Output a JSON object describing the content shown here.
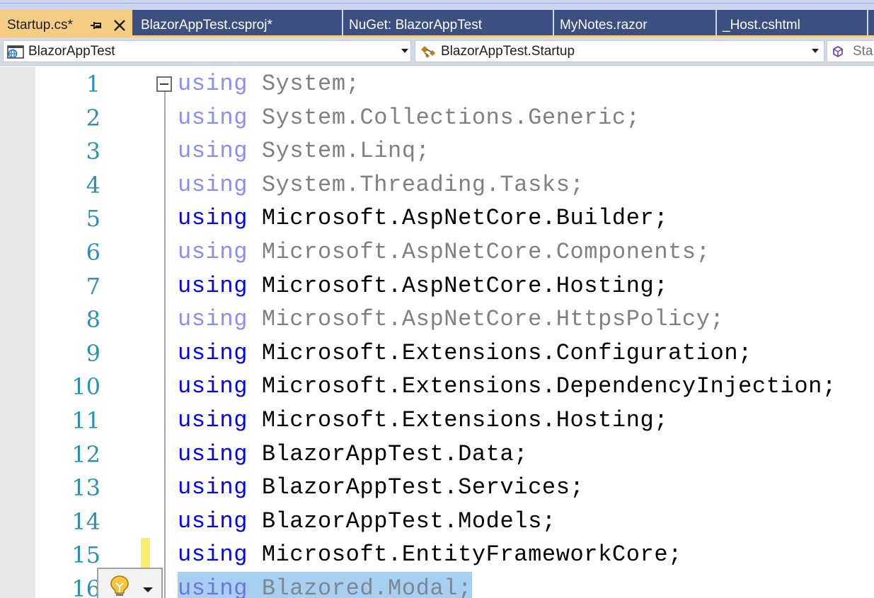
{
  "tabs": [
    {
      "label": "Startup.cs*",
      "active": true
    },
    {
      "label": "BlazorAppTest.csproj*",
      "active": false
    },
    {
      "label": "NuGet: BlazorAppTest",
      "active": false
    },
    {
      "label": "MyNotes.razor",
      "active": false
    },
    {
      "label": "_Host.cshtml",
      "active": false
    }
  ],
  "nav": {
    "project": "BlazorAppTest",
    "type": "BlazorAppTest.Startup",
    "member": "Sta"
  },
  "code": {
    "keyword": "using",
    "lines": [
      {
        "number": "1",
        "text": "System;",
        "unused": true
      },
      {
        "number": "2",
        "text": "System.Collections.Generic;",
        "unused": true
      },
      {
        "number": "3",
        "text": "System.Linq;",
        "unused": true
      },
      {
        "number": "4",
        "text": "System.Threading.Tasks;",
        "unused": true
      },
      {
        "number": "5",
        "text": "Microsoft.AspNetCore.Builder;",
        "unused": false
      },
      {
        "number": "6",
        "text": "Microsoft.AspNetCore.Components;",
        "unused": true
      },
      {
        "number": "7",
        "text": "Microsoft.AspNetCore.Hosting;",
        "unused": false
      },
      {
        "number": "8",
        "text": "Microsoft.AspNetCore.HttpsPolicy;",
        "unused": true
      },
      {
        "number": "9",
        "text": "Microsoft.Extensions.Configuration;",
        "unused": false
      },
      {
        "number": "10",
        "text": "Microsoft.Extensions.DependencyInjection;",
        "unused": false
      },
      {
        "number": "11",
        "text": "Microsoft.Extensions.Hosting;",
        "unused": false
      },
      {
        "number": "12",
        "text": "BlazorAppTest.Data;",
        "unused": false
      },
      {
        "number": "13",
        "text": "BlazorAppTest.Services;",
        "unused": false
      },
      {
        "number": "14",
        "text": "BlazorAppTest.Models;",
        "unused": false
      },
      {
        "number": "15",
        "text": "Microsoft.EntityFrameworkCore;",
        "unused": false
      },
      {
        "number": "16",
        "text": "Blazored.Modal;",
        "unused": true,
        "selected": true
      }
    ]
  },
  "colors": {
    "active_tab": "#f5cc84",
    "tab_bar": "#3b4f81",
    "line_number": "#2b91af",
    "keyword": "#0000ff",
    "selection": "#a6cff2",
    "change_marker": "#f6ef6e"
  },
  "icons": {
    "pin": "pin-icon",
    "close": "close-icon",
    "project": "csharp-project-icon",
    "type": "class-icon",
    "member": "member-icon",
    "quick_actions": "lightbulb-icon"
  }
}
